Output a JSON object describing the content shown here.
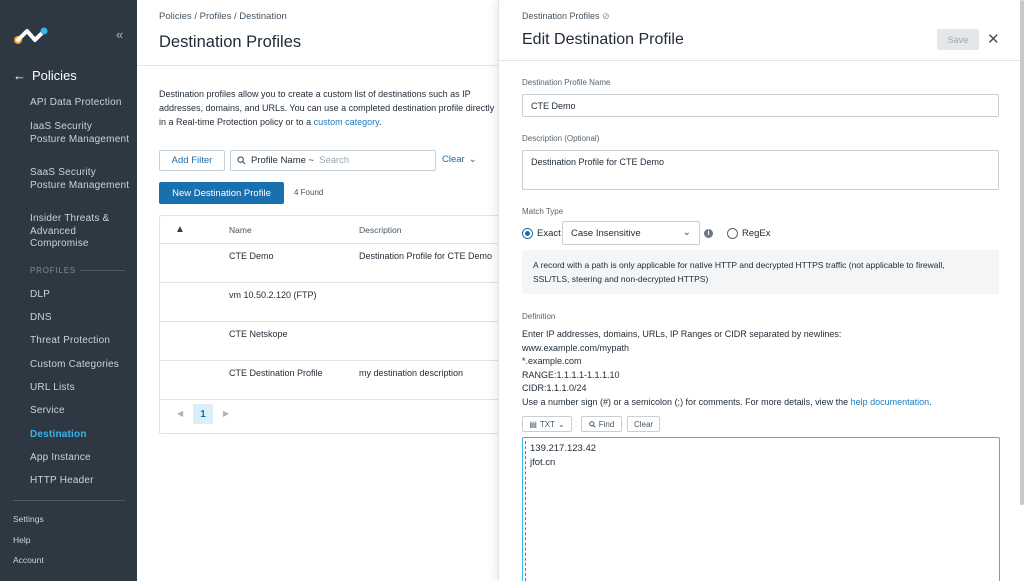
{
  "sidebar": {
    "back_label": "Policies",
    "items_top": [
      {
        "label": "API Data Protection"
      },
      {
        "label": "IaaS Security Posture Management"
      },
      {
        "label": "SaaS Security Posture Management"
      },
      {
        "label": "Insider Threats & Advanced Compromise"
      }
    ],
    "section_label": "PROFILES",
    "items_profiles": [
      {
        "label": "DLP"
      },
      {
        "label": "DNS"
      },
      {
        "label": "Threat Protection"
      },
      {
        "label": "Custom Categories"
      },
      {
        "label": "URL Lists"
      },
      {
        "label": "Service"
      },
      {
        "label": "Destination"
      },
      {
        "label": "App Instance"
      },
      {
        "label": "HTTP Header"
      }
    ],
    "bottom": [
      {
        "label": "Settings"
      },
      {
        "label": "Help"
      },
      {
        "label": "Account"
      }
    ],
    "colors": {
      "background": "#2d3843",
      "active": "#38b4ee"
    }
  },
  "main": {
    "breadcrumb": "Policies / Profiles / Destination",
    "title": "Destination Profiles",
    "intro_line1": "Destination profiles allow you to create a custom list of destinations such as IP",
    "intro_line2": "addresses, domains, and URLs. You can use a completed destination profile directly",
    "intro_line3_pre": "in a Real-time Protection policy or to a ",
    "intro_link": "custom category",
    "intro_line3_post": ".",
    "add_filter": "Add Filter",
    "filter_field": "Profile Name ~",
    "filter_placeholder": "Search",
    "clear_label": "Clear",
    "new_button": "New Destination Profile",
    "found": "4 Found",
    "table": {
      "headers": {
        "name": "Name",
        "description": "Description"
      },
      "rows": [
        {
          "name": "CTE Demo",
          "description": "Destination Profile for CTE Demo"
        },
        {
          "name": "vm 10.50.2.120 (FTP)",
          "description": ""
        },
        {
          "name": "CTE Netskope",
          "description": ""
        },
        {
          "name": "CTE Destination Profile",
          "description": "my destination description"
        }
      ]
    },
    "pager": {
      "page": "1"
    }
  },
  "drawer": {
    "breadcrumb": "Destination Profiles",
    "title": "Edit Destination Profile",
    "save_label": "Save",
    "name_label": "Destination Profile Name",
    "name_value": "CTE Demo",
    "desc_label": "Description (Optional)",
    "desc_value": "Destination Profile for CTE Demo",
    "match_label": "Match Type",
    "exact_label": "Exact",
    "case_value": "Case Insensitive",
    "regex_label": "RegEx",
    "note_line1": "A record with a path is only applicable for native HTTP and decrypted HTTPS traffic (not applicable to firewall,",
    "note_line2": "SSL/TLS, steering and non-decrypted HTTPS)",
    "definition_label": "Definition",
    "def_lines": [
      "Enter IP addresses, domains, URLs, IP Ranges or CIDR separated by newlines:",
      "www.example.com/mypath",
      "*.example.com",
      "RANGE:1.1.1.1-1.1.1.10",
      "CIDR:1.1.1.0/24"
    ],
    "def_comment_pre": "Use a number sign (#) or a semicolon (;) for comments. For more details, view the ",
    "def_comment_link": "help documentation",
    "def_comment_post": ".",
    "tools": {
      "txt": "TXT",
      "find": "Find",
      "clear": "Clear"
    },
    "editor_lines": [
      "139.217.123.42",
      "jfot.cn"
    ]
  },
  "colors": {
    "primary": "#1a6fae",
    "link": "#1a7dc0",
    "editor_focus": "#38b4ee"
  }
}
